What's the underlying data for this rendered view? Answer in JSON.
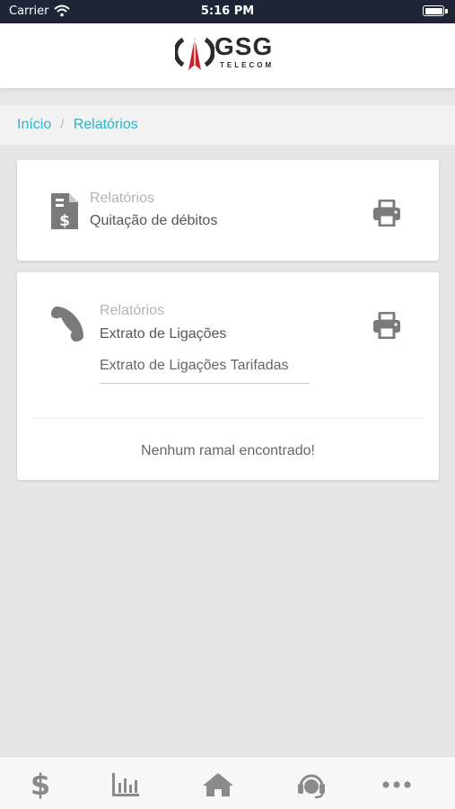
{
  "status_bar": {
    "carrier": "Carrier",
    "time": "5:16 PM"
  },
  "header": {
    "brand": "GSG",
    "subtitle": "TELECOM"
  },
  "breadcrumb": {
    "items": [
      "Início",
      "Relatórios"
    ],
    "separator": "/"
  },
  "cards": [
    {
      "kicker": "Relatórios",
      "title": "Quitação de débitos",
      "icon": "invoice-dollar-icon",
      "action_icon": "print-icon"
    },
    {
      "kicker": "Relatórios",
      "title": "Extrato de Ligações",
      "icon": "phone-icon",
      "action_icon": "print-icon",
      "select_value": "Extrato de Ligações Tarifadas",
      "empty_message": "Nenhum ramal encontrado!"
    }
  ],
  "tabbar": {
    "items": [
      {
        "icon": "dollar-icon",
        "glyph": "$"
      },
      {
        "icon": "bar-chart-icon"
      },
      {
        "icon": "home-icon"
      },
      {
        "icon": "headset-icon"
      },
      {
        "icon": "more-icon"
      }
    ]
  },
  "colors": {
    "status_bar_bg": "#1f2537",
    "accent_link": "#2bb3c9",
    "icon_gray": "#7a7a7a",
    "logo_red": "#c8262c",
    "page_bg": "#e6e6e6"
  }
}
